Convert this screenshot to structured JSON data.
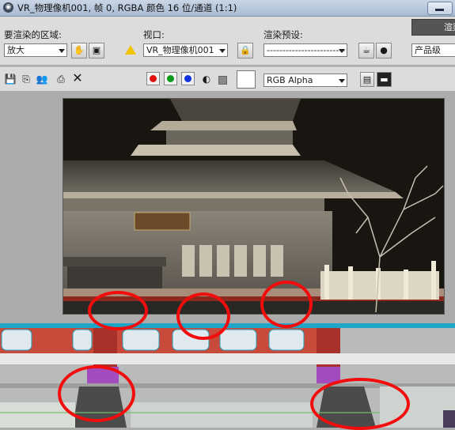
{
  "window": {
    "title": "VR_物理像机001, 帧 0, RGBA 颜色 16 位/通道 (1:1)"
  },
  "render_panel": {
    "area_label": "要渲染的区域:",
    "area_value": "放大",
    "viewport_label": "视口:",
    "viewport_value": "VR_物理像机001",
    "preset_label": "渲染预设:",
    "preset_value": "-------------------------",
    "render_button_label": "渲染",
    "quality_value": "产品级"
  },
  "toolbar": {
    "channel_value": "RGB Alpha",
    "channel_colors": {
      "red": "#e01010",
      "green": "#0a9a1a",
      "blue": "#1030e0"
    }
  },
  "colors": {
    "accent_annotation": "#f20d0d",
    "panel_bg": "#dcdcdc",
    "frame_bg": "#171511"
  }
}
